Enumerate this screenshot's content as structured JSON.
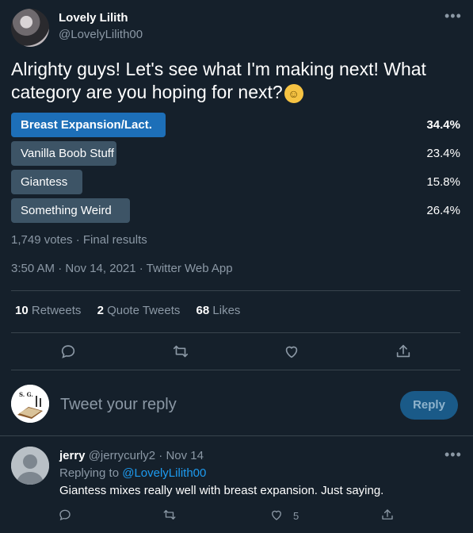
{
  "tweet": {
    "author_name": "Lovely Lilith",
    "author_handle": "@LovelyLilith00",
    "more_label": "•••",
    "text": "Alrighty guys! Let's see what I'm making next! What category are you hoping for next?",
    "emoji": "☺",
    "poll": {
      "options": [
        {
          "label": "Breast Expansion/Lact.",
          "percent_text": "34.4%",
          "percent": 34.4,
          "winner": true
        },
        {
          "label": "Vanilla Boob Stuff",
          "percent_text": "23.4%",
          "percent": 23.4,
          "winner": false
        },
        {
          "label": "Giantess",
          "percent_text": "15.8%",
          "percent": 15.8,
          "winner": false
        },
        {
          "label": "Something Weird",
          "percent_text": "26.4%",
          "percent": 26.4,
          "winner": false
        }
      ],
      "summary": "1,749 votes · Final results"
    },
    "timestamp": "3:50 AM · Nov 14, 2021 · Twitter Web App",
    "stats": {
      "retweets_count": "10",
      "retweets_label": "Retweets",
      "quotes_count": "2",
      "quotes_label": "Quote Tweets",
      "likes_count": "68",
      "likes_label": "Likes"
    }
  },
  "reply_box": {
    "placeholder": "Tweet your reply",
    "button_label": "Reply",
    "avatar_text": "S. G."
  },
  "reply": {
    "author_name": "jerry",
    "meta": "@jerrycurly2 · Nov 14",
    "replying_prefix": "Replying to",
    "replying_handle": "@LovelyLilith00",
    "text": "Giantess mixes really well with breast expansion. Just saying.",
    "like_count": "5",
    "more_label": "•••"
  },
  "colors": {
    "background": "#15202b",
    "winner_bar": "#1d6fb8",
    "bar": "#3d5466",
    "link": "#1d9bf0"
  }
}
